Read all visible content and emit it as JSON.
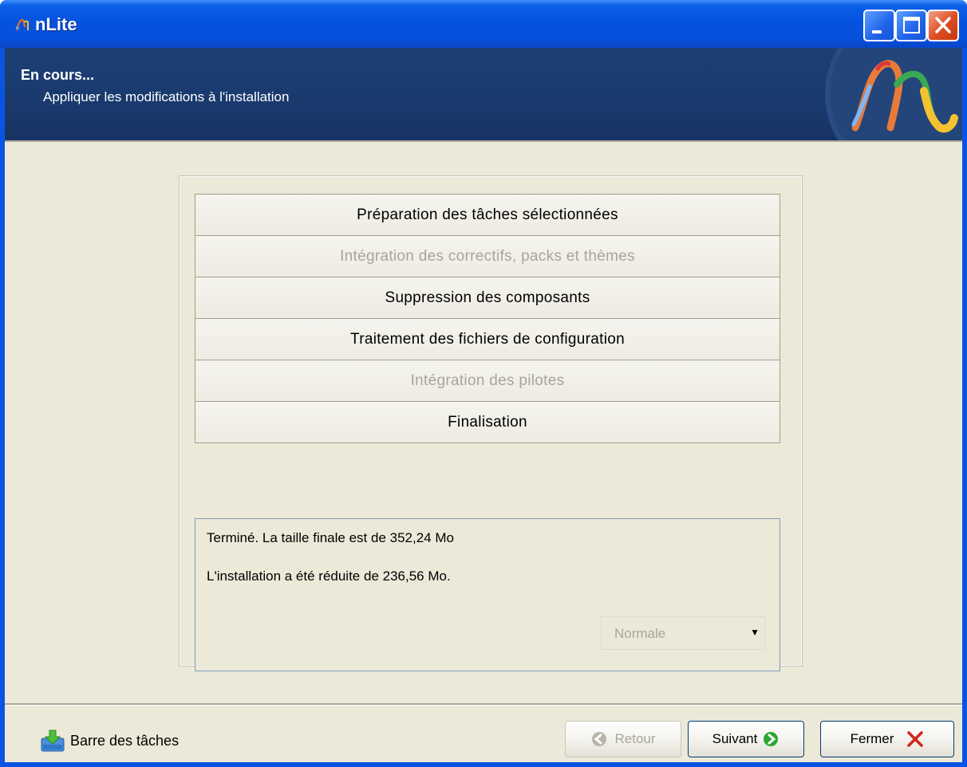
{
  "window": {
    "title": "nLite"
  },
  "header": {
    "title": "En cours...",
    "subtitle": "Appliquer les modifications à l'installation"
  },
  "steps": [
    {
      "label": "Préparation des tâches sélectionnées",
      "enabled": true
    },
    {
      "label": "Intégration des correctifs, packs et thèmes",
      "enabled": false
    },
    {
      "label": "Suppression des composants",
      "enabled": true
    },
    {
      "label": "Traitement des fichiers de configuration",
      "enabled": true
    },
    {
      "label": "Intégration des pilotes",
      "enabled": false
    },
    {
      "label": "Finalisation",
      "enabled": true
    }
  ],
  "log": {
    "line1": "Terminé. La taille finale est de 352,24 Mo",
    "line2": "L'installation a été réduite de 236,56 Mo.",
    "priority": "Normale"
  },
  "footer": {
    "taskbar_label": "Barre des tâches",
    "back_label": "Retour",
    "next_label": "Suivant",
    "close_label": "Fermer"
  },
  "icons": [
    "nlite-logo-icon",
    "minimize-icon",
    "maximize-icon",
    "close-icon",
    "taskbar-download-icon",
    "back-arrow-icon",
    "next-arrow-icon",
    "close-x-icon"
  ],
  "colors": {
    "title_bar": "#0553e0",
    "header_bg": "#1a3a6e",
    "client_bg": "#ece9d8",
    "disabled_text": "#a7a69b",
    "next_icon": "#2fa62f",
    "close_x": "#d3251c"
  }
}
